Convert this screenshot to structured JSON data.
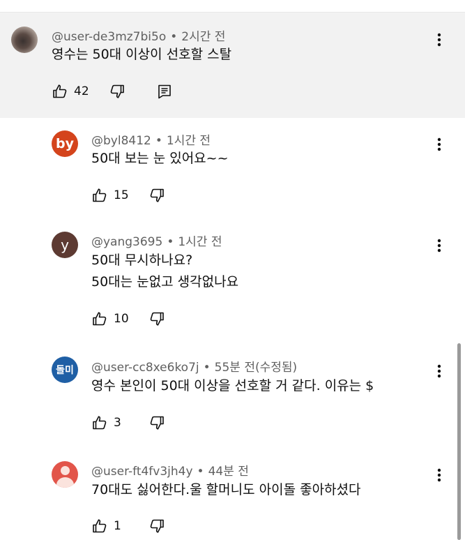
{
  "comments": [
    {
      "author": "@user-de3mz7bi5o",
      "time": "2시간 전",
      "lines": [
        "영수는 50대 이상이 선호할 스탈"
      ],
      "likes": "42"
    },
    {
      "author": "@byl8412",
      "time": "1시간 전",
      "avatar_text": "by",
      "lines": [
        "50대 보는 눈 있어요~~"
      ],
      "likes": "15"
    },
    {
      "author": "@yang3695",
      "time": "1시간 전",
      "avatar_text": "y",
      "lines": [
        "50대 무시하나요?",
        "50대는  눈없고 생각없나요"
      ],
      "likes": "10"
    },
    {
      "author": "@user-cc8xe6ko7j",
      "time": "55분 전(수정됨)",
      "avatar_text": "돌미",
      "lines": [
        "영수 본인이 50대 이상을 선호할 거 같다. 이유는 $"
      ],
      "likes": "3"
    },
    {
      "author": "@user-ft4fv3jh4y",
      "time": "44분 전",
      "lines": [
        "70대도 싫어한다.울 할머니도 아이돌 좋아하셨다"
      ],
      "likes": "1"
    }
  ],
  "colors": {
    "highlight_bg": "#f2f2f2",
    "avatar_by": "#d4441c",
    "avatar_y": "#5d3a32",
    "avatar_dolmi": "#1f5fa5",
    "avatar_person": "#e2554a"
  }
}
